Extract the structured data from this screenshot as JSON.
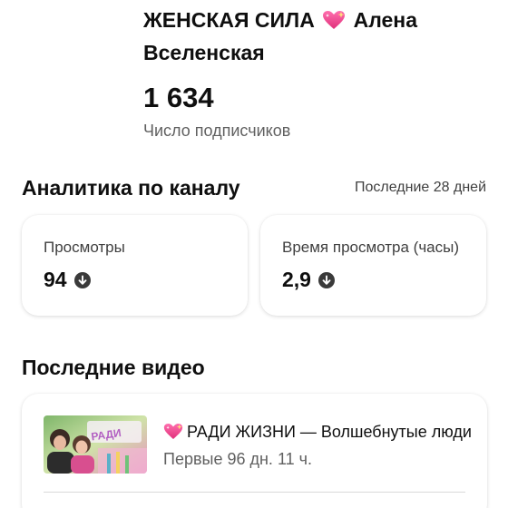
{
  "channel": {
    "name_part1": "ЖЕНСКАЯ СИЛА",
    "name_part2": "Алена",
    "name_line2": "Вселенская",
    "subscribers": "1 634",
    "subscribers_label": "Число подписчиков"
  },
  "analytics": {
    "title": "Аналитика по каналу",
    "period": "Последние 28 дней",
    "metrics": [
      {
        "label": "Просмотры",
        "value": "94",
        "trend": "down"
      },
      {
        "label": "Время просмотра (часы)",
        "value": "2,9",
        "trend": "down"
      }
    ]
  },
  "latest": {
    "title": "Последние видео",
    "video": {
      "title": "РАДИ ЖИЗНИ — Волшебнутые люди",
      "meta": "Первые 96 дн. 11 ч.",
      "thumbnail_icon": "video-thumbnail"
    }
  },
  "icons": {
    "heart": "sparkling-heart-icon",
    "trend": "arrow-down-circle-icon"
  },
  "colors": {
    "heart": "#e8458b",
    "text": "#0f0f0f",
    "secondary": "#606060"
  }
}
